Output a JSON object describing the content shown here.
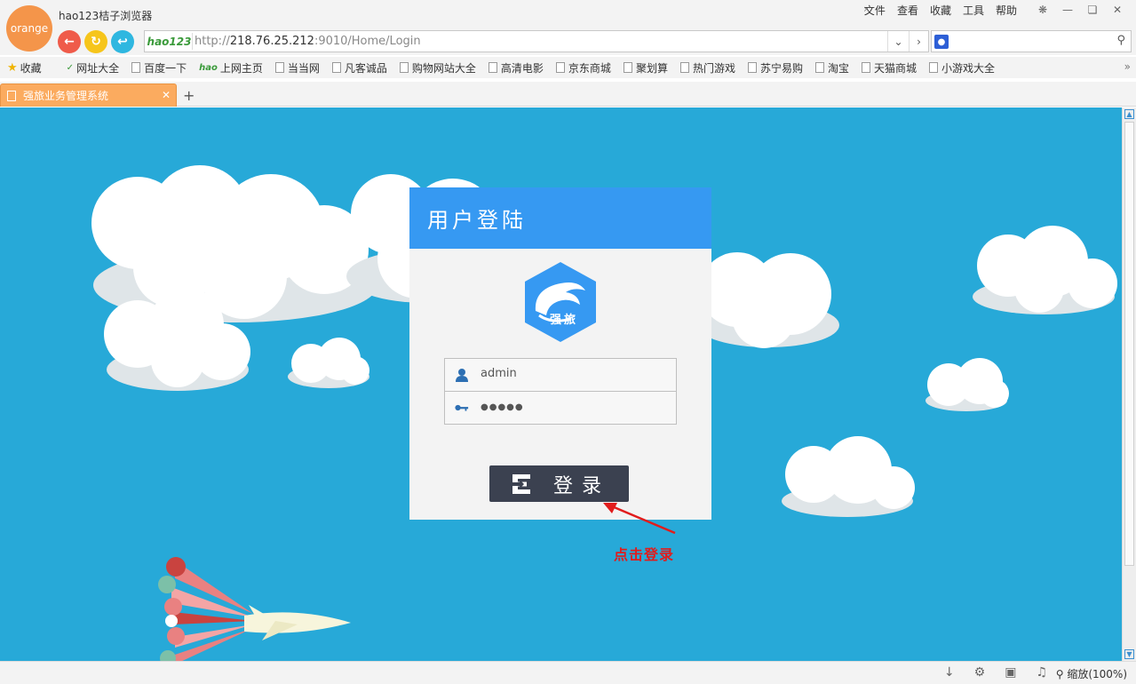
{
  "browser": {
    "logo_text": "orange",
    "app_title": "hao123桔子浏览器",
    "menu": [
      "文件",
      "查看",
      "收藏",
      "工具",
      "帮助"
    ],
    "address": {
      "badge": "hao123",
      "url_scheme": "http://",
      "url_host": "218.76.25.212",
      "url_rest": ":9010/Home/Login"
    },
    "bookmarks": [
      {
        "label": "收藏",
        "icon": "star-icon"
      },
      {
        "label": "网址大全",
        "icon": "hao-icon"
      },
      {
        "label": "百度一下",
        "icon": "page-icon"
      },
      {
        "label": "上网主页",
        "icon": "hao-icon"
      },
      {
        "label": "当当网",
        "icon": "page-icon"
      },
      {
        "label": "凡客诚品",
        "icon": "page-icon"
      },
      {
        "label": "购物网站大全",
        "icon": "page-icon"
      },
      {
        "label": "高清电影",
        "icon": "page-icon"
      },
      {
        "label": "京东商城",
        "icon": "page-icon"
      },
      {
        "label": "聚划算",
        "icon": "page-icon"
      },
      {
        "label": "热门游戏",
        "icon": "page-icon"
      },
      {
        "label": "苏宁易购",
        "icon": "page-icon"
      },
      {
        "label": "淘宝",
        "icon": "page-icon"
      },
      {
        "label": "天猫商城",
        "icon": "page-icon"
      },
      {
        "label": "小游戏大全",
        "icon": "page-icon"
      }
    ],
    "tab": {
      "title": "强旅业务管理系统"
    },
    "new_tab": "+",
    "zoom": "缩放(100%)"
  },
  "login": {
    "heading": "用户登陆",
    "logo_text": "强旅",
    "username": "admin",
    "password_mask": "●●●●●",
    "button_label": "登录"
  },
  "annotation": {
    "hint": "点击登录"
  },
  "colors": {
    "page_bg": "#27a9d8",
    "login_header": "#3699f2",
    "login_button": "#3b4150",
    "hint": "#e11c1c",
    "tab_active": "#fbab5f"
  }
}
